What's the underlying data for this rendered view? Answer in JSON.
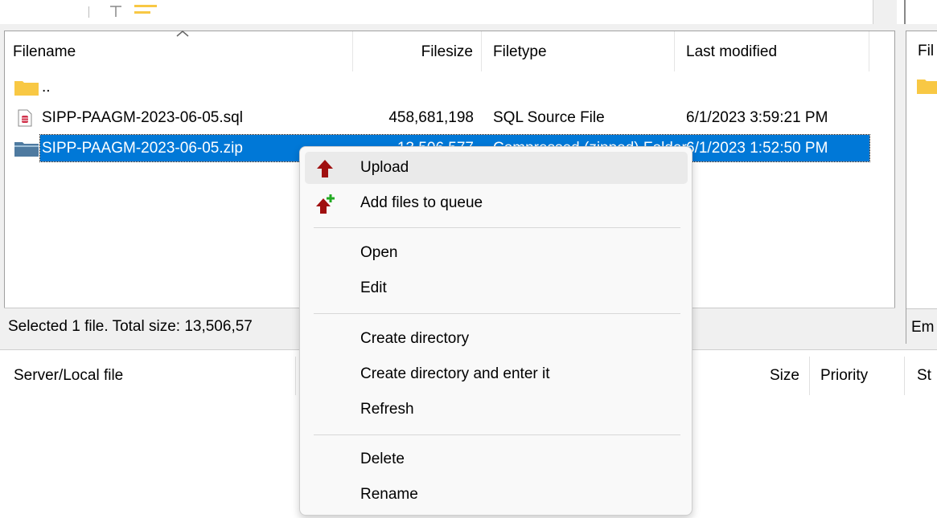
{
  "local_pane": {
    "columns": {
      "filename": "Filename",
      "filesize": "Filesize",
      "filetype": "Filetype",
      "last_modified": "Last modified"
    },
    "rows": [
      {
        "name": "..",
        "size": "",
        "type": "",
        "modified": "",
        "icon": "folder-icon"
      },
      {
        "name": "SIPP-PAAGM-2023-06-05.sql",
        "size": "458,681,198",
        "type": "SQL Source File",
        "modified": "6/1/2023 3:59:21 PM",
        "icon": "sql-file-icon"
      },
      {
        "name": "SIPP-PAAGM-2023-06-05.zip",
        "size": "13,506,577",
        "type": "Compressed (zipped) Folder",
        "modified": "6/1/2023 1:52:50 PM",
        "icon": "zip-folder-icon",
        "selected": true
      }
    ],
    "status": "Selected 1 file. Total size: 13,506,57"
  },
  "remote_pane": {
    "header_fragment": "Fil",
    "status_fragment": "Em"
  },
  "queue": {
    "columns": {
      "server_local": "Server/Local file",
      "size": "Size",
      "priority": "Priority",
      "status": "St"
    }
  },
  "context_menu": {
    "items": [
      {
        "label": "Upload",
        "icon": "upload-arrow-icon"
      },
      {
        "label": "Add files to queue",
        "icon": "add-to-queue-icon"
      },
      {
        "label": "Open"
      },
      {
        "label": "Edit"
      },
      {
        "label": "Create directory"
      },
      {
        "label": "Create directory and enter it"
      },
      {
        "label": "Refresh"
      },
      {
        "label": "Delete"
      },
      {
        "label": "Rename"
      }
    ]
  },
  "colors": {
    "selection": "#0078d7",
    "folder": "#f8c844",
    "upload_arrow": "#a01010",
    "add_plus": "#22aa22"
  }
}
